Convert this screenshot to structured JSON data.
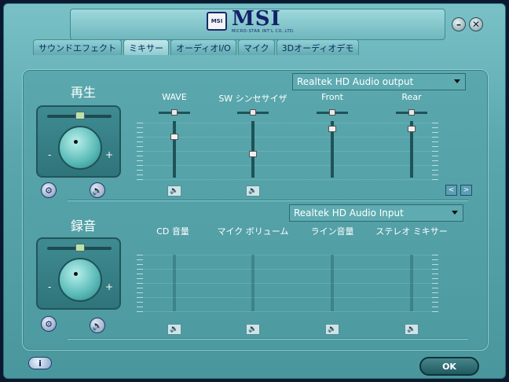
{
  "app": {
    "logo_text": "MSI",
    "logo_subtext": "MICRO-STAR INT'L CO.,LTD.",
    "shield_text": "MSI"
  },
  "window": {
    "minimize_glyph": "–",
    "close_glyph": "✕"
  },
  "tabs": [
    {
      "label": "サウンドエフェクト",
      "active": false
    },
    {
      "label": "ミキサー",
      "active": true
    },
    {
      "label": "オーディオI/O",
      "active": false
    },
    {
      "label": "マイク",
      "active": false
    },
    {
      "label": "3Dオーディオデモ",
      "active": false
    }
  ],
  "playback": {
    "title": "再生",
    "device": "Realtek HD Audio output",
    "minus": "-",
    "plus": "+",
    "channels": [
      {
        "label": "WAVE",
        "level": 0.75
      },
      {
        "label": "SW シンセサイザ",
        "level": 0.4
      },
      {
        "label": "Front",
        "level": 0.9
      },
      {
        "label": "Rear",
        "level": 0.9
      }
    ]
  },
  "recording": {
    "title": "録音",
    "device": "Realtek HD Audio Input",
    "minus": "-",
    "plus": "+",
    "channels": [
      {
        "label": "CD 音量"
      },
      {
        "label": "マイク ボリューム"
      },
      {
        "label": "ライン音量"
      },
      {
        "label": "ステレオ ミキサー"
      }
    ]
  },
  "buttons": {
    "ok": "OK",
    "info": "i",
    "nav_prev": "<",
    "nav_next": ">"
  },
  "icons": {
    "mute": "🔈",
    "speaker": "🔊",
    "tune": "⚙"
  }
}
